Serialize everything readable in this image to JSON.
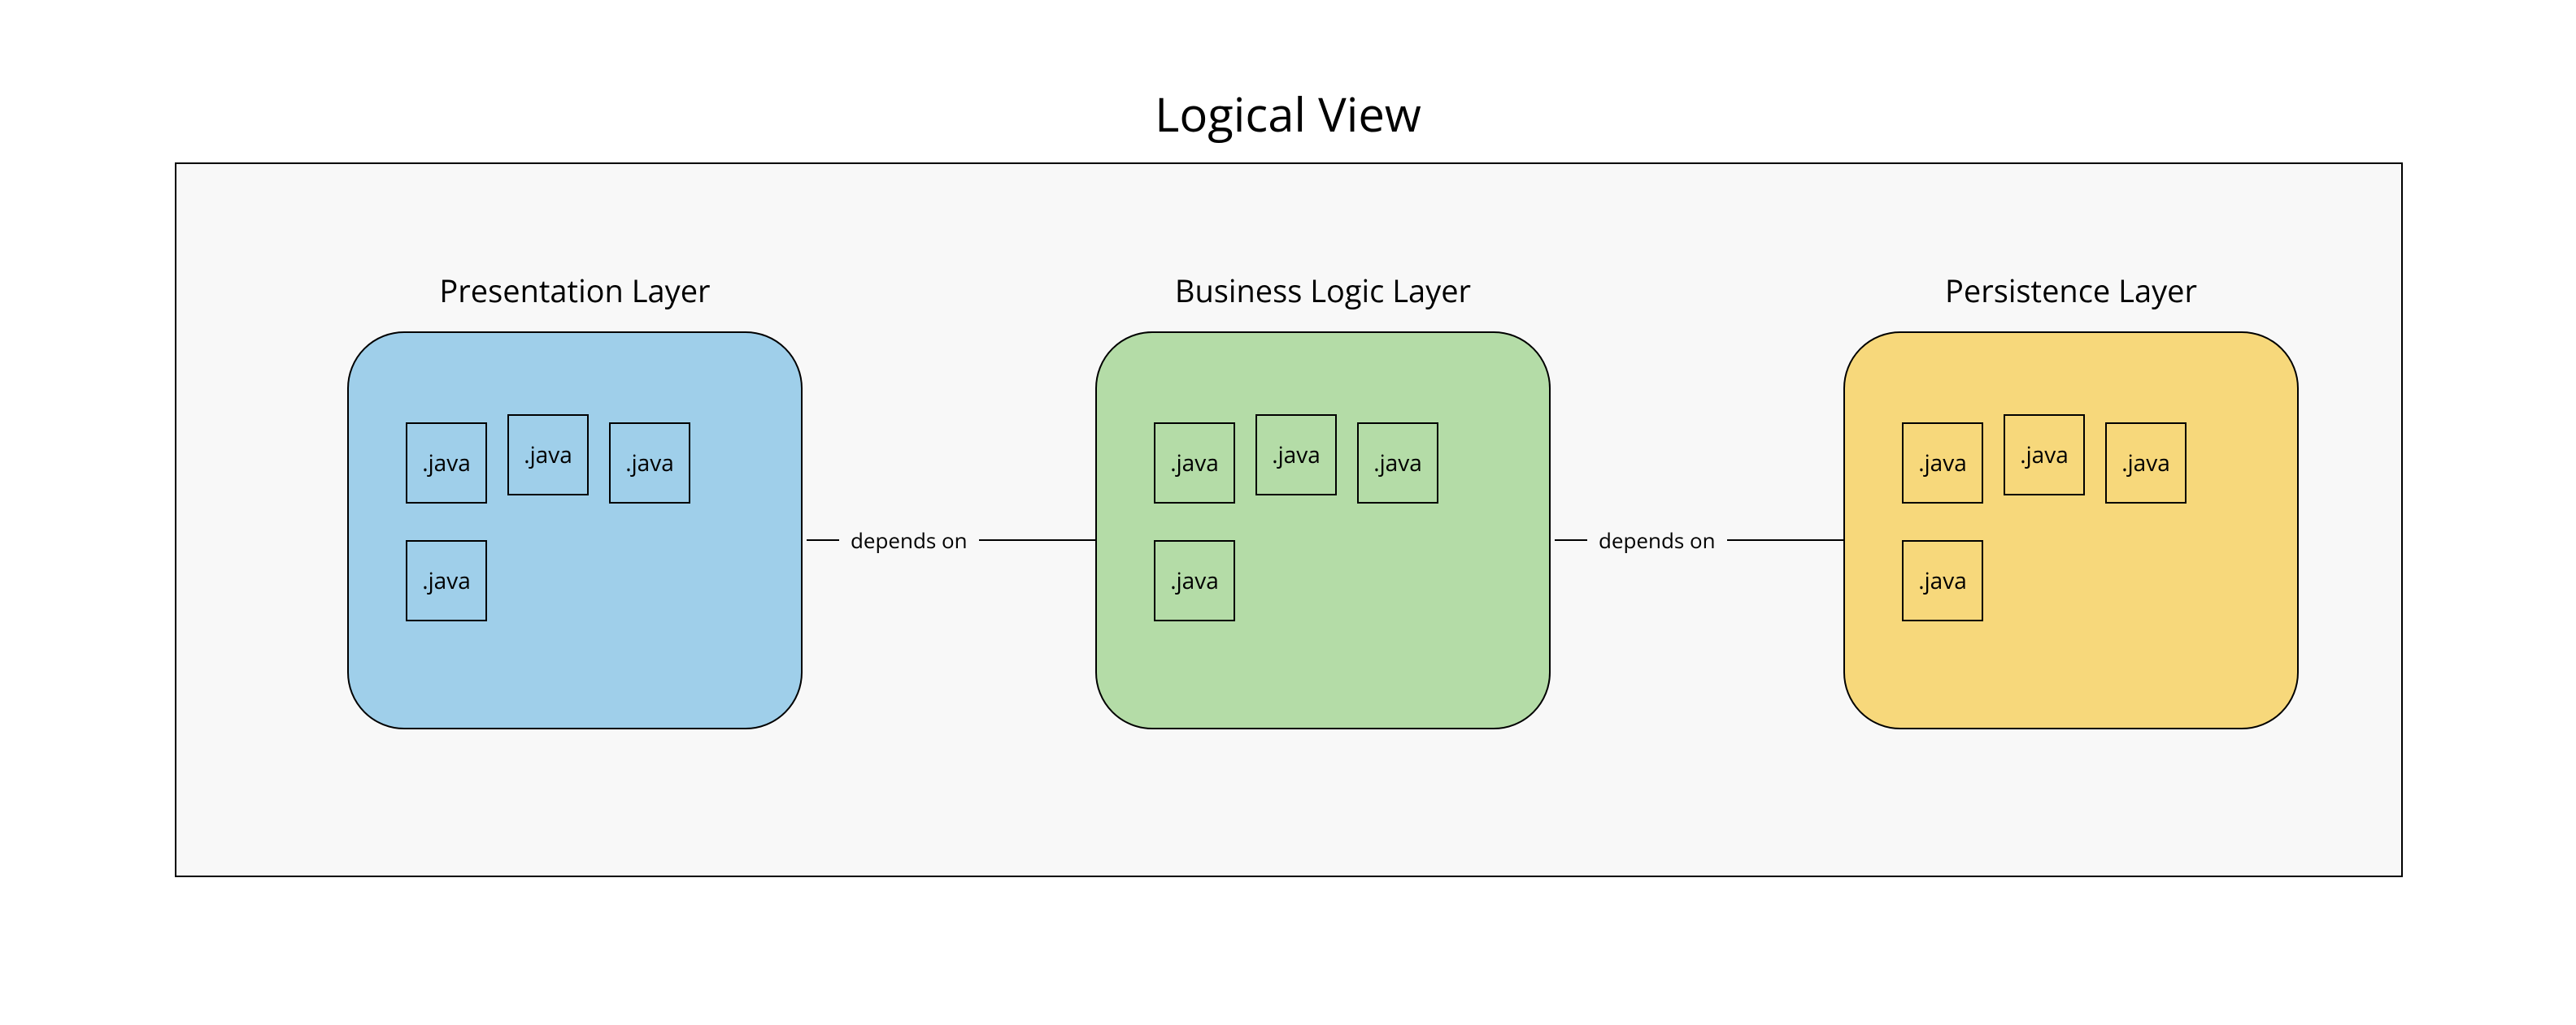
{
  "title": "Logical View",
  "layers": [
    {
      "label": "Presentation Layer",
      "color": "blue",
      "files": [
        ".java",
        ".java",
        ".java",
        ".java"
      ]
    },
    {
      "label": "Business Logic Layer",
      "color": "green",
      "files": [
        ".java",
        ".java",
        ".java",
        ".java"
      ]
    },
    {
      "label": "Persistence Layer",
      "color": "yellow",
      "files": [
        ".java",
        ".java",
        ".java",
        ".java"
      ]
    }
  ],
  "arrows": [
    {
      "label": "depends on"
    },
    {
      "label": "depends on"
    }
  ]
}
